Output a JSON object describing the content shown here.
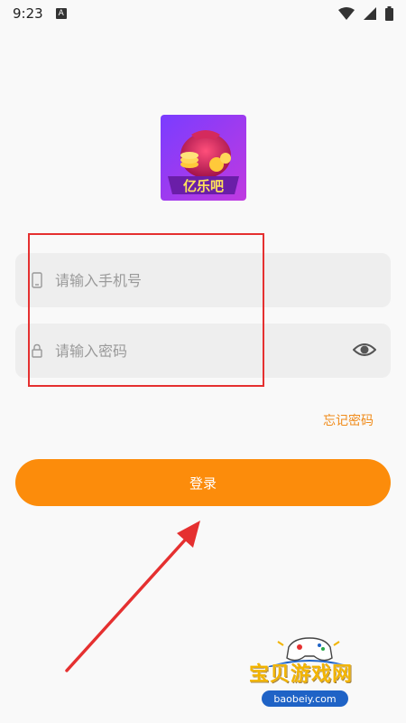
{
  "status_bar": {
    "time": "9:23",
    "a_badge": "A",
    "icons": [
      "wifi-icon",
      "signal-icon",
      "battery-icon"
    ]
  },
  "app": {
    "logo_text": "亿乐吧",
    "logo_icon": "money-bag-icon"
  },
  "form": {
    "phone_placeholder": "请输入手机号",
    "phone_icon": "phone-icon",
    "password_placeholder": "请输入密码",
    "password_icon": "lock-icon",
    "toggle_icon": "eye-icon",
    "forgot_label": "忘记密码",
    "login_label": "登录"
  },
  "watermark": {
    "title": "宝贝游戏网",
    "url": "baobeiy.com"
  },
  "colors": {
    "accent": "#fc8c0b",
    "forgot": "#f08b1a",
    "annotation": "#e53030",
    "field_bg": "#eeeeee"
  }
}
